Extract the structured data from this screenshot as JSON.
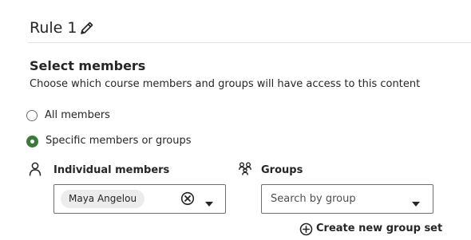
{
  "rule": {
    "title": "Rule 1",
    "edit_icon": "pencil-icon"
  },
  "section": {
    "title": "Select members",
    "description": "Choose which course members and groups will have access to this content"
  },
  "radio_options": [
    {
      "label": "All members",
      "checked": false
    },
    {
      "label": "Specific members or groups",
      "checked": true
    }
  ],
  "individual": {
    "label": "Individual members",
    "icon": "person-icon",
    "selected_chip": "Maya Angelou",
    "clear_icon": "circle-x-icon",
    "caret_icon": "caret-down-icon"
  },
  "groups": {
    "label": "Groups",
    "icon": "groups-icon",
    "placeholder": "Search by group",
    "caret_icon": "caret-down-icon"
  },
  "create_group": {
    "label": "Create new group set",
    "icon": "plus-circle-icon"
  },
  "colors": {
    "accent": "#3c7a3c",
    "text": "#262626",
    "border": "#6e6e6e",
    "chip": "#ececec"
  }
}
